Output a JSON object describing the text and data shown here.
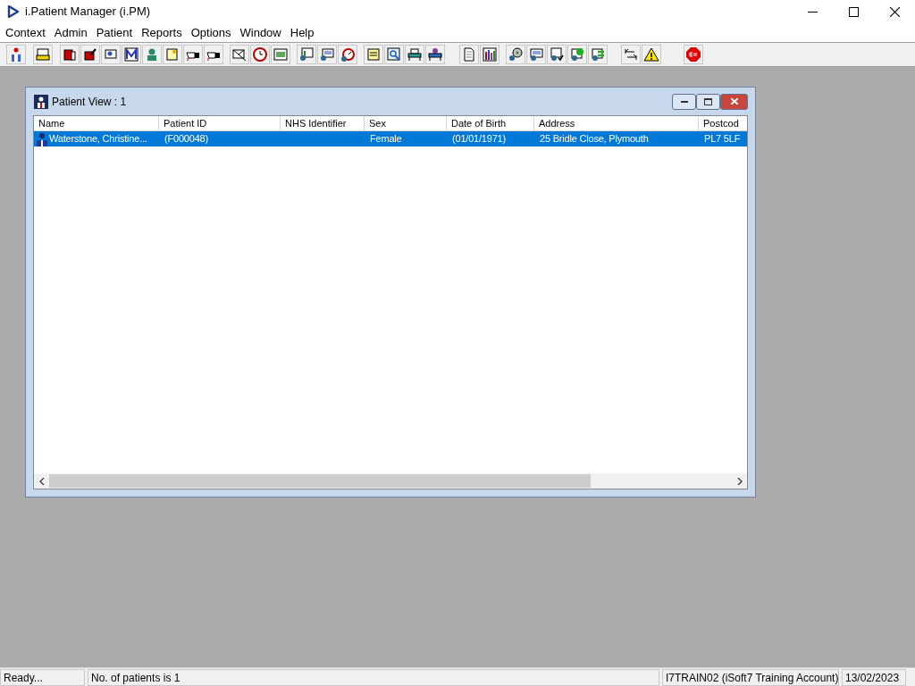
{
  "window": {
    "title": "i.Patient Manager (i.PM)"
  },
  "menu": [
    "Context",
    "Admin",
    "Patient",
    "Reports",
    "Options",
    "Window",
    "Help"
  ],
  "child_window": {
    "title": "Patient View : 1",
    "columns": [
      "Name",
      "Patient ID",
      "NHS Identifier",
      "Sex",
      "Date of Birth",
      "Address",
      "Postcod"
    ],
    "rows": [
      {
        "selected": true,
        "cells": [
          "Waterstone, Christine...",
          "(F000048)",
          "",
          "Female",
          "(01/01/1971)",
          "25 Bridle Close, Plymouth",
          "PL7 5LF"
        ]
      }
    ]
  },
  "status_bar": [
    "Ready...",
    "No. of patients is 1",
    "I7TRAIN02 (iSoft7 Training Account)",
    "13/02/2023"
  ]
}
